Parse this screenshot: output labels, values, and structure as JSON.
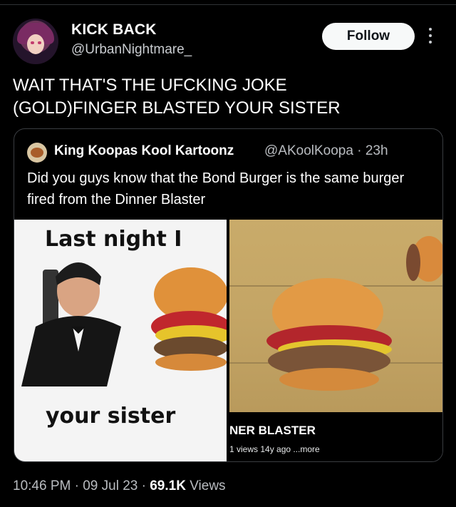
{
  "author": {
    "name": "KICK BACK",
    "handle": "@UrbanNightmare_"
  },
  "follow_label": "Follow",
  "tweet": {
    "line1": "WAIT THAT'S THE UFCKING JOKE",
    "line2": "(GOLD)FINGER BLASTED YOUR SISTER"
  },
  "quote": {
    "name": "King Koopas Kool Kartoonz",
    "handle_time": "@AKoolKoopa · 23h",
    "text": "Did you guys know that the Bond Burger is the same burger fired from the Dinner Blaster",
    "meme_top": "Last night I",
    "meme_bottom": "your sister",
    "video_title": "NER BLASTER",
    "video_meta": "1 views  14y ago  ...more"
  },
  "footer": {
    "time_date": "10:46 PM · 09 Jul 23 · ",
    "views_count": "69.1K",
    "views_label": " Views"
  },
  "icons": {
    "more": "more-vertical-icon"
  },
  "colors": {
    "background": "#000000",
    "follow_bg": "#f7f9f9",
    "secondary_text": "#b9bcc0"
  }
}
